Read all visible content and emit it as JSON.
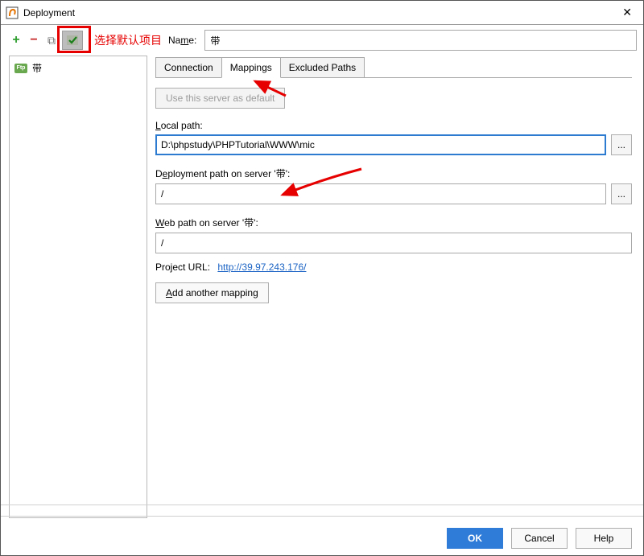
{
  "title": "Deployment",
  "toolbar": {
    "add": "+",
    "remove": "−",
    "copy": "⧉",
    "annotation": "选择默认项目"
  },
  "name_label": "Name:",
  "name_value": "带",
  "sidebar": {
    "items": [
      {
        "label": "带",
        "icon": "Ftp"
      }
    ]
  },
  "tabs": {
    "connection": "Connection",
    "mappings": "Mappings",
    "excluded": "Excluded Paths"
  },
  "mappings": {
    "use_default_btn": "Use this server as default",
    "local_path_label": "Local path:",
    "local_path_value": "D:\\phpstudy\\PHPTutorial\\WWW\\mic",
    "deploy_path_label": "Deployment path on server '带':",
    "deploy_path_value": "/",
    "web_path_label": "Web path on server '带':",
    "web_path_value": "/",
    "project_url_label": "Project URL:",
    "project_url_value": "http://39.97.243.176/",
    "add_mapping_btn": "Add another mapping",
    "browse": "..."
  },
  "buttons": {
    "ok": "OK",
    "cancel": "Cancel",
    "help": "Help"
  }
}
